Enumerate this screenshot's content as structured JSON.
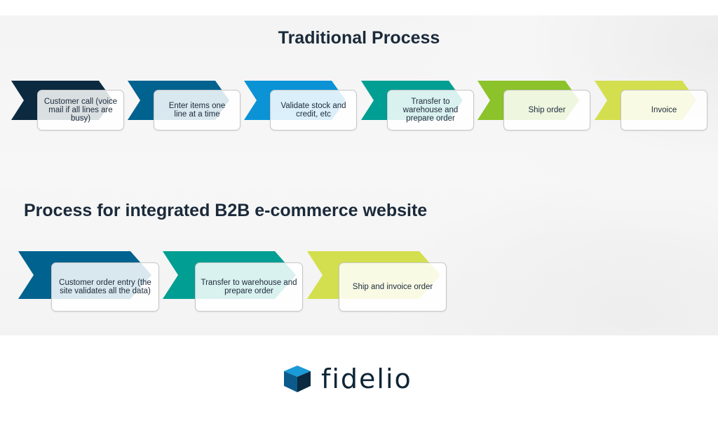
{
  "traditional": {
    "title": "Traditional Process",
    "steps": [
      {
        "label": "Customer call (voice mail if all lines are busy)",
        "color": "#0b2a40"
      },
      {
        "label": "Enter items one line at a time",
        "color": "#00628f"
      },
      {
        "label": "Validate stock and credit, etc",
        "color": "#0b93d6"
      },
      {
        "label": "Transfer to warehouse and prepare order",
        "color": "#009e93"
      },
      {
        "label": "Ship order",
        "color": "#8cc22a"
      },
      {
        "label": "Invoice",
        "color": "#d3df4e"
      }
    ]
  },
  "integrated": {
    "title": "Process for integrated B2B e-commerce website",
    "steps": [
      {
        "label": "Customer order entry (the site validates all the data)",
        "color": "#00628f"
      },
      {
        "label": "Transfer to warehouse and prepare order",
        "color": "#009e93"
      },
      {
        "label": "Ship and invoice order",
        "color": "#d3df4e"
      }
    ]
  },
  "logo": {
    "text": "fidelio",
    "cube_colors": [
      "#1a9ad6",
      "#0a5b8c",
      "#0b2a40"
    ]
  }
}
